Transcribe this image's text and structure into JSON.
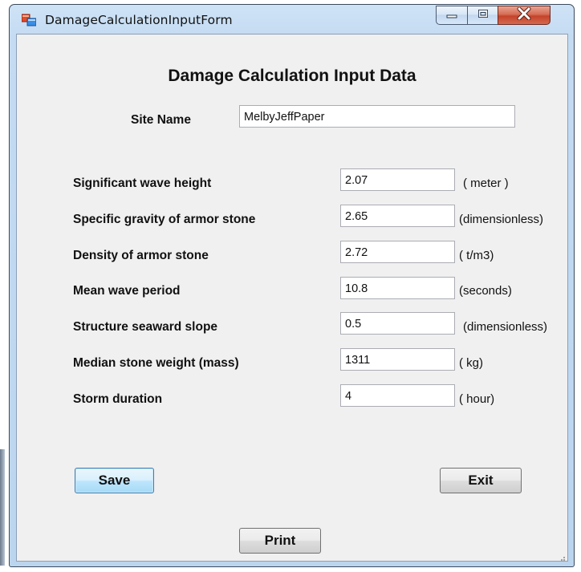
{
  "window": {
    "title": "DamageCalculationInputForm"
  },
  "form": {
    "heading": "Damage Calculation Input Data",
    "site_name_label": "Site Name",
    "site_name_value": "MelbyJeffPaper",
    "fields": [
      {
        "label": "Significant wave height",
        "value": "2.07",
        "unit": "( meter )"
      },
      {
        "label": "Specific gravity of armor stone",
        "value": "2.65",
        "unit": "(dimensionless)"
      },
      {
        "label": "Density of armor stone",
        "value": "2.72",
        "unit": "( t/m3)"
      },
      {
        "label": "Mean wave period",
        "value": "10.8",
        "unit": "(seconds)"
      },
      {
        "label": "Structure seaward slope",
        "value": "0.5",
        "unit": "(dimensionless)"
      },
      {
        "label": "Median stone weight (mass)",
        "value": "1311",
        "unit": "( kg)"
      },
      {
        "label": "Storm duration",
        "value": "4",
        "unit": "( hour)"
      }
    ]
  },
  "buttons": {
    "save": "Save",
    "exit": "Exit",
    "print": "Print"
  },
  "colors": {
    "client_bg": "#f0f0f0",
    "titlebar_bg": "#c4dbf2",
    "close_button": "#c4432b",
    "focused_button_border": "#3c7fb1"
  },
  "icons": {
    "app": "app-form-icon",
    "minimize": "minimize-icon",
    "maximize": "maximize-icon",
    "close": "close-icon",
    "resize_grip": "resize-grip-icon"
  }
}
